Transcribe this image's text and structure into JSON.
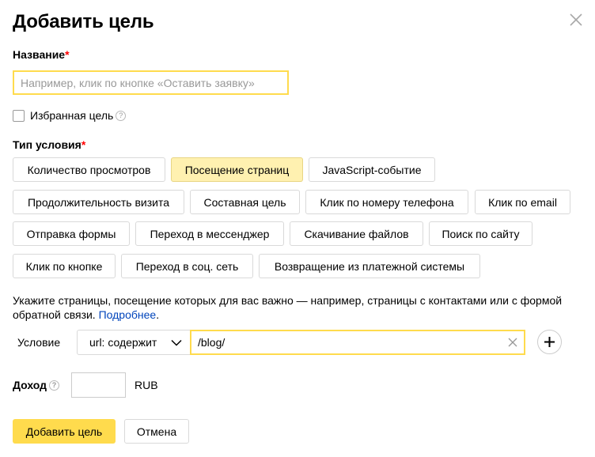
{
  "dialog": {
    "title": "Добавить цель",
    "close_icon": "close-icon"
  },
  "name_field": {
    "label": "Название",
    "required_mark": "*",
    "placeholder": "Например, клик по кнопке «Оставить заявку»",
    "value": ""
  },
  "favorite": {
    "label": "Избранная цель",
    "checked": false,
    "help_glyph": "?"
  },
  "condition_type": {
    "label": "Тип условия",
    "required_mark": "*",
    "options": [
      {
        "label": "Количество просмотров",
        "selected": false
      },
      {
        "label": "Посещение страниц",
        "selected": true
      },
      {
        "label": "JavaScript-событие",
        "selected": false
      },
      {
        "label": "Продолжительность визита",
        "selected": false
      },
      {
        "label": "Составная цель",
        "selected": false
      },
      {
        "label": "Клик по номеру телефона",
        "selected": false
      },
      {
        "label": "Клик по email",
        "selected": false
      },
      {
        "label": "Отправка формы",
        "selected": false
      },
      {
        "label": "Переход в мессенджер",
        "selected": false
      },
      {
        "label": "Скачивание файлов",
        "selected": false
      },
      {
        "label": "Поиск по сайту",
        "selected": false
      },
      {
        "label": "Клик по кнопке",
        "selected": false
      },
      {
        "label": "Переход в соц. сеть",
        "selected": false
      },
      {
        "label": "Возвращение из платежной системы",
        "selected": false
      }
    ]
  },
  "hint": {
    "text": "Укажите страницы, посещение которых для вас важно — например, страницы с контактами или с формой обратной связи.",
    "link": "Подробнее",
    "end": "."
  },
  "condition": {
    "label": "Условие",
    "operator": "url: содержит",
    "value": "/blog/",
    "add_icon": "plus-icon"
  },
  "income": {
    "label": "Доход",
    "help_glyph": "?",
    "value": "",
    "currency": "RUB"
  },
  "actions": {
    "submit": "Добавить цель",
    "cancel": "Отмена"
  },
  "colors": {
    "accent": "#ffdb4d",
    "selected_bg": "#fff1b0",
    "required": "#ff0000",
    "link": "#0044bb"
  }
}
